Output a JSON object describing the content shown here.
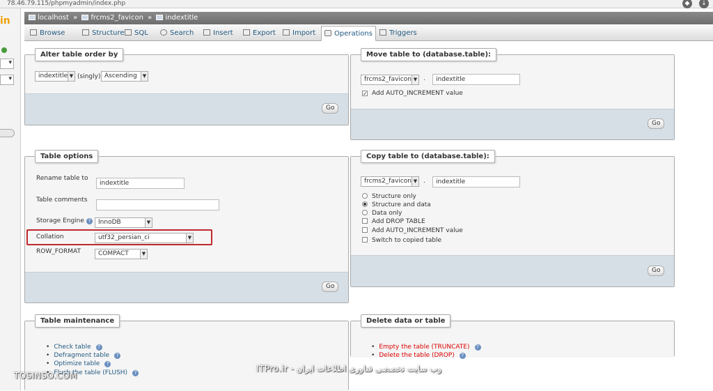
{
  "browser": {
    "url": "78.46.79.115/phpmyadmin/index.php"
  },
  "sidebar": {
    "logo": "in"
  },
  "breadcrumb": {
    "server": "localhost",
    "database": "frcms2_favicon",
    "table": "indextitle",
    "sep": "»"
  },
  "tabs": [
    {
      "label": "Browse",
      "icon": "browse-icon"
    },
    {
      "label": "Structure",
      "icon": "structure-icon"
    },
    {
      "label": "SQL",
      "icon": "sql-icon"
    },
    {
      "label": "Search",
      "icon": "search-icon"
    },
    {
      "label": "Insert",
      "icon": "insert-icon"
    },
    {
      "label": "Export",
      "icon": "export-icon"
    },
    {
      "label": "Import",
      "icon": "import-icon"
    },
    {
      "label": "Operations",
      "icon": "wrench-icon",
      "active": true
    },
    {
      "label": "Triggers",
      "icon": "triggers-icon"
    }
  ],
  "alter_order": {
    "legend": "Alter table order by",
    "column": "indextitle",
    "singly": "(singly)",
    "direction": "Ascending",
    "go": "Go"
  },
  "move_table": {
    "legend": "Move table to (database.table):",
    "database": "frcms2_favicon",
    "dot": ".",
    "table": "indextitle",
    "auto_increment": "Add AUTO_INCREMENT value",
    "go": "Go"
  },
  "table_options": {
    "legend": "Table options",
    "rename_label": "Rename table to",
    "rename_value": "indextitle",
    "comments_label": "Table comments",
    "comments_value": "",
    "engine_label": "Storage Engine",
    "engine_value": "InnoDB",
    "collation_label": "Collation",
    "collation_value": "utf32_persian_ci",
    "row_format_label": "ROW_FORMAT",
    "row_format_value": "COMPACT",
    "go": "Go"
  },
  "copy_table": {
    "legend": "Copy table to (database.table):",
    "database": "frcms2_favicon",
    "dot": ".",
    "table": "indextitle",
    "options": [
      {
        "label": "Structure only",
        "type": "radio",
        "checked": false
      },
      {
        "label": "Structure and data",
        "type": "radio",
        "checked": true
      },
      {
        "label": "Data only",
        "type": "radio",
        "checked": false
      },
      {
        "label": "Add DROP TABLE",
        "type": "checkbox",
        "checked": false
      },
      {
        "label": "Add AUTO_INCREMENT value",
        "type": "checkbox",
        "checked": false
      },
      {
        "label": "Switch to copied table",
        "type": "checkbox",
        "checked": false
      }
    ],
    "go": "Go"
  },
  "maintenance": {
    "legend": "Table maintenance",
    "items": [
      "Check table",
      "Defragment table",
      "Optimize table",
      "Flush the table (FLUSH)"
    ]
  },
  "delete": {
    "legend": "Delete data or table",
    "items": [
      "Empty the table (TRUNCATE)",
      "Delete the table (DROP)"
    ]
  },
  "watermarks": {
    "left": "TOSINSO.COM",
    "center": "وب سایت تخصصی فناوری اطلاعات ایران - ITPro.ir"
  }
}
